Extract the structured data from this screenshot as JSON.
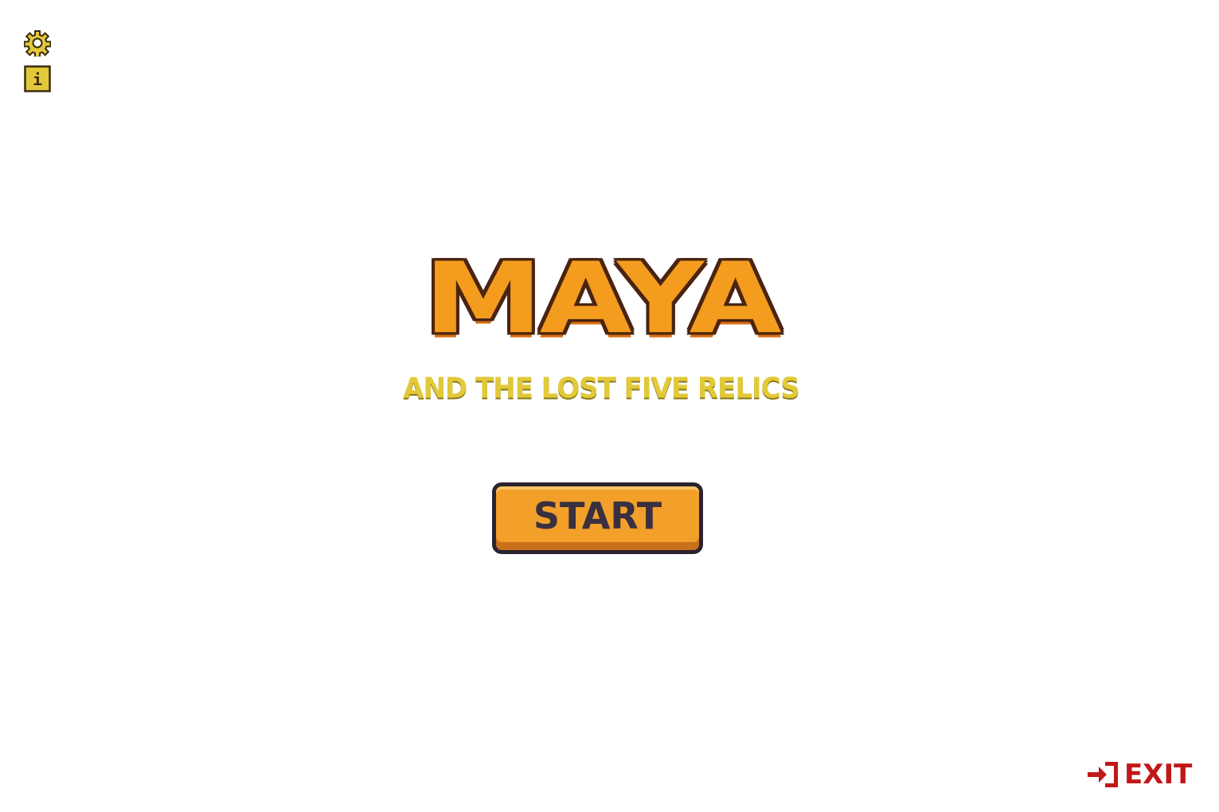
{
  "title": {
    "main": "MAYA",
    "subtitle": "AND THE LOST FIVE RELICS"
  },
  "menu": {
    "start_label": "START",
    "exit_label": "EXIT"
  },
  "icons": {
    "settings": "gear-icon",
    "info": "info-icon",
    "exit": "exit-door-icon",
    "info_glyph": "i"
  },
  "colors": {
    "title_fill": "#f39c1e",
    "title_outline": "#4a2410",
    "subtitle": "#e2c93a",
    "button_fill": "#f2a02a",
    "button_text": "#3a3040",
    "exit": "#c01818",
    "icon_yellow": "#e2c93a"
  }
}
